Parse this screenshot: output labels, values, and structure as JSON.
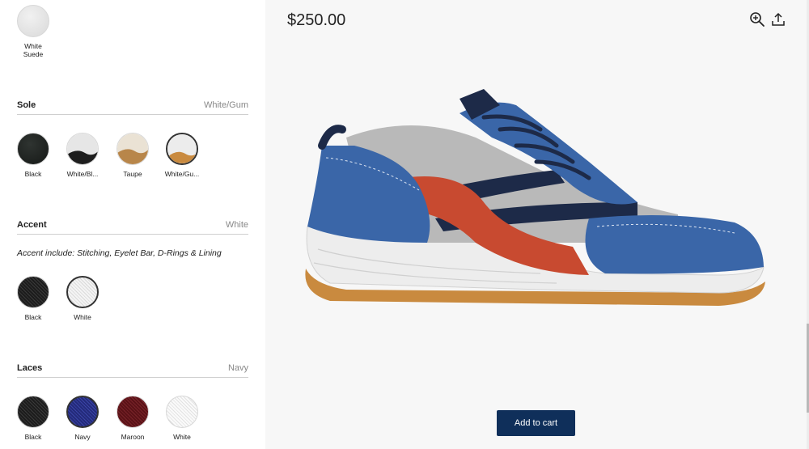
{
  "upper": {
    "options": [
      {
        "label": "White\nSuede",
        "fill": "suede",
        "selected": false
      }
    ]
  },
  "sole": {
    "title": "Sole",
    "value": "White/Gum",
    "options": [
      {
        "label": "Black",
        "fill": "black"
      },
      {
        "label": "White/Bl...",
        "fill": "white-black"
      },
      {
        "label": "Taupe",
        "fill": "taupe"
      },
      {
        "label": "White/Gu...",
        "fill": "white-gum",
        "selected": true
      }
    ]
  },
  "accent": {
    "title": "Accent",
    "value": "White",
    "note": "Accent include: Stitching, Eyelet Bar, D-Rings & Lining",
    "options": [
      {
        "label": "Black",
        "fill": "black-mesh"
      },
      {
        "label": "White",
        "fill": "white-mesh",
        "selected": true
      }
    ]
  },
  "laces": {
    "title": "Laces",
    "value": "Navy",
    "options": [
      {
        "label": "Black",
        "fill": "black-mesh"
      },
      {
        "label": "Navy",
        "fill": "navy-mesh",
        "selected": true
      },
      {
        "label": "Maroon",
        "fill": "maroon-mesh"
      },
      {
        "label": "White",
        "fill": "lace-white"
      }
    ]
  },
  "preview": {
    "price": "$250.00",
    "zoom_icon": "zoom-in-icon",
    "share_icon": "share-upload-icon",
    "add_to_cart": "Add to cart"
  },
  "colors": {
    "cart_button": "#0f2f5a",
    "shoe_blue": "#3a66a8",
    "shoe_red": "#c84a30",
    "shoe_navy": "#1d2a48",
    "gum": "#c98a3f"
  }
}
